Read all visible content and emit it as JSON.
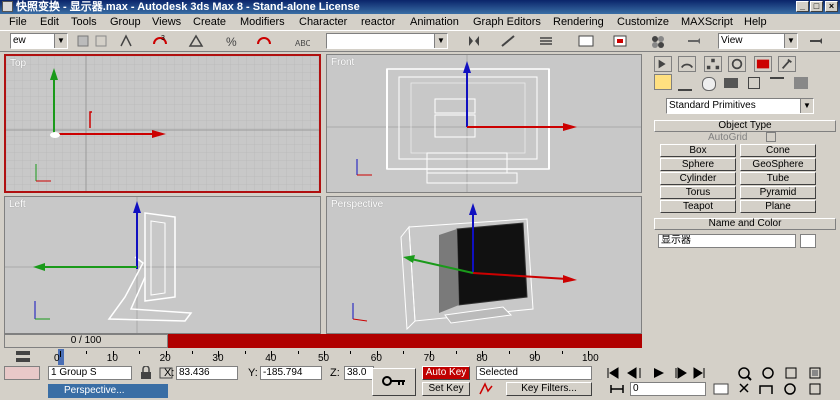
{
  "window": {
    "title": "快照变换 - 显示器.max - Autodesk 3ds Max 8 - Stand-alone License"
  },
  "menu": [
    "File",
    "Edit",
    "Tools",
    "Group",
    "Views",
    "Create",
    "Modifiers",
    "Character",
    "reactor",
    "Animation",
    "Graph Editors",
    "Rendering",
    "Customize",
    "MAXScript",
    "Help"
  ],
  "toolbar": {
    "selection_filter": "ew",
    "named_selection": "",
    "view_dropdown": "View"
  },
  "viewports": {
    "top": "Top",
    "front": "Front",
    "left": "Left",
    "perspective": "Perspective"
  },
  "command_panel": {
    "category": "Standard Primitives",
    "object_type_title": "Object Type",
    "autogrid": "AutoGrid",
    "buttons": [
      "Box",
      "Cone",
      "Sphere",
      "GeoSphere",
      "Cylinder",
      "Tube",
      "Torus",
      "Pyramid",
      "Teapot",
      "Plane"
    ],
    "name_color_title": "Name and Color",
    "object_name": "显示器"
  },
  "timeline": {
    "slider": "0 / 100",
    "ticks": [
      0,
      10,
      20,
      30,
      40,
      50,
      60,
      70,
      80,
      90,
      100
    ]
  },
  "status": {
    "selection": "1 Group S",
    "x_label": "X:",
    "x_value": "83.436",
    "y_label": "Y:",
    "y_value": "-185.794",
    "z_label": "Z:",
    "z_value": "38.0",
    "auto_key": "Auto Key",
    "set_key": "Set Key",
    "key_mode": "Selected",
    "key_filters": "Key Filters...",
    "frame": "0",
    "taskbar": "Perspective..."
  },
  "colors": {
    "active_border": "#b01010",
    "timeline_red": "#b00000",
    "auto_key_red": "#c00000"
  }
}
